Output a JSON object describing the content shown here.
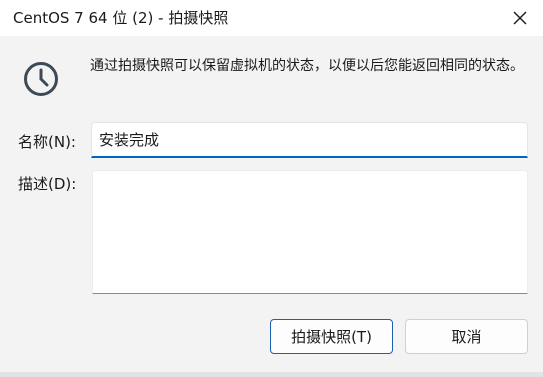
{
  "window": {
    "title": "CentOS 7 64 位 (2) - 拍摄快照"
  },
  "icons": {
    "close": "close-icon",
    "clock": "clock-icon"
  },
  "info": {
    "text": "通过拍摄快照可以保留虚拟机的状态，以便以后您能返回相同的状态。"
  },
  "form": {
    "name_label": "名称(N):",
    "name_value": "安装完成",
    "desc_label": "描述(D):",
    "desc_value": ""
  },
  "buttons": {
    "take_snapshot": "拍摄快照(T)",
    "cancel": "取消"
  },
  "colors": {
    "accent": "#0067c0",
    "icon": "#3d4a55"
  }
}
